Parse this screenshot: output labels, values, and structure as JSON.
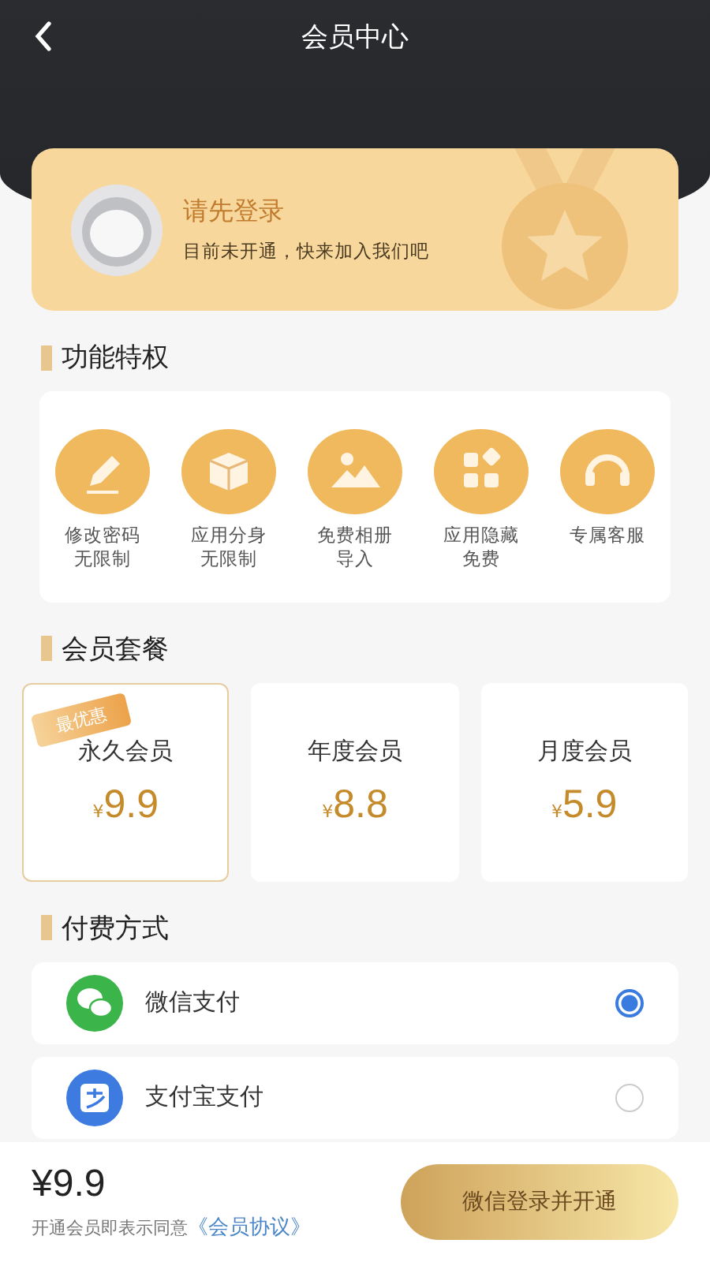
{
  "header": {
    "title": "会员中心"
  },
  "profile": {
    "name": "请先登录",
    "subtitle": "目前未开通，快来加入我们吧"
  },
  "features": {
    "title": "功能特权",
    "items": [
      {
        "kind": "pencil",
        "label": "修改密码无限制"
      },
      {
        "kind": "box",
        "label": "应用分身无限制"
      },
      {
        "kind": "photo",
        "label": "免费相册导入"
      },
      {
        "kind": "apps",
        "label": "应用隐藏免费"
      },
      {
        "kind": "headset",
        "label": "专属客服"
      }
    ]
  },
  "plans": {
    "title": "会员套餐",
    "items": [
      {
        "name": "永久会员",
        "currency": "¥",
        "price": "9.9",
        "selected": true,
        "badge": "最优惠"
      },
      {
        "name": "年度会员",
        "currency": "¥",
        "price": "8.8",
        "selected": false
      },
      {
        "name": "月度会员",
        "currency": "¥",
        "price": "5.9",
        "selected": false
      }
    ]
  },
  "payment": {
    "title": "付费方式",
    "methods": [
      {
        "kind": "wechat",
        "name": "微信支付",
        "selected": true
      },
      {
        "kind": "alipay",
        "name": "支付宝支付",
        "selected": false
      }
    ]
  },
  "footer": {
    "price": "¥9.9",
    "agreement": "开通会员即表示同意",
    "agreement_link": "《会员协议》",
    "button": "微信登录并开通"
  }
}
